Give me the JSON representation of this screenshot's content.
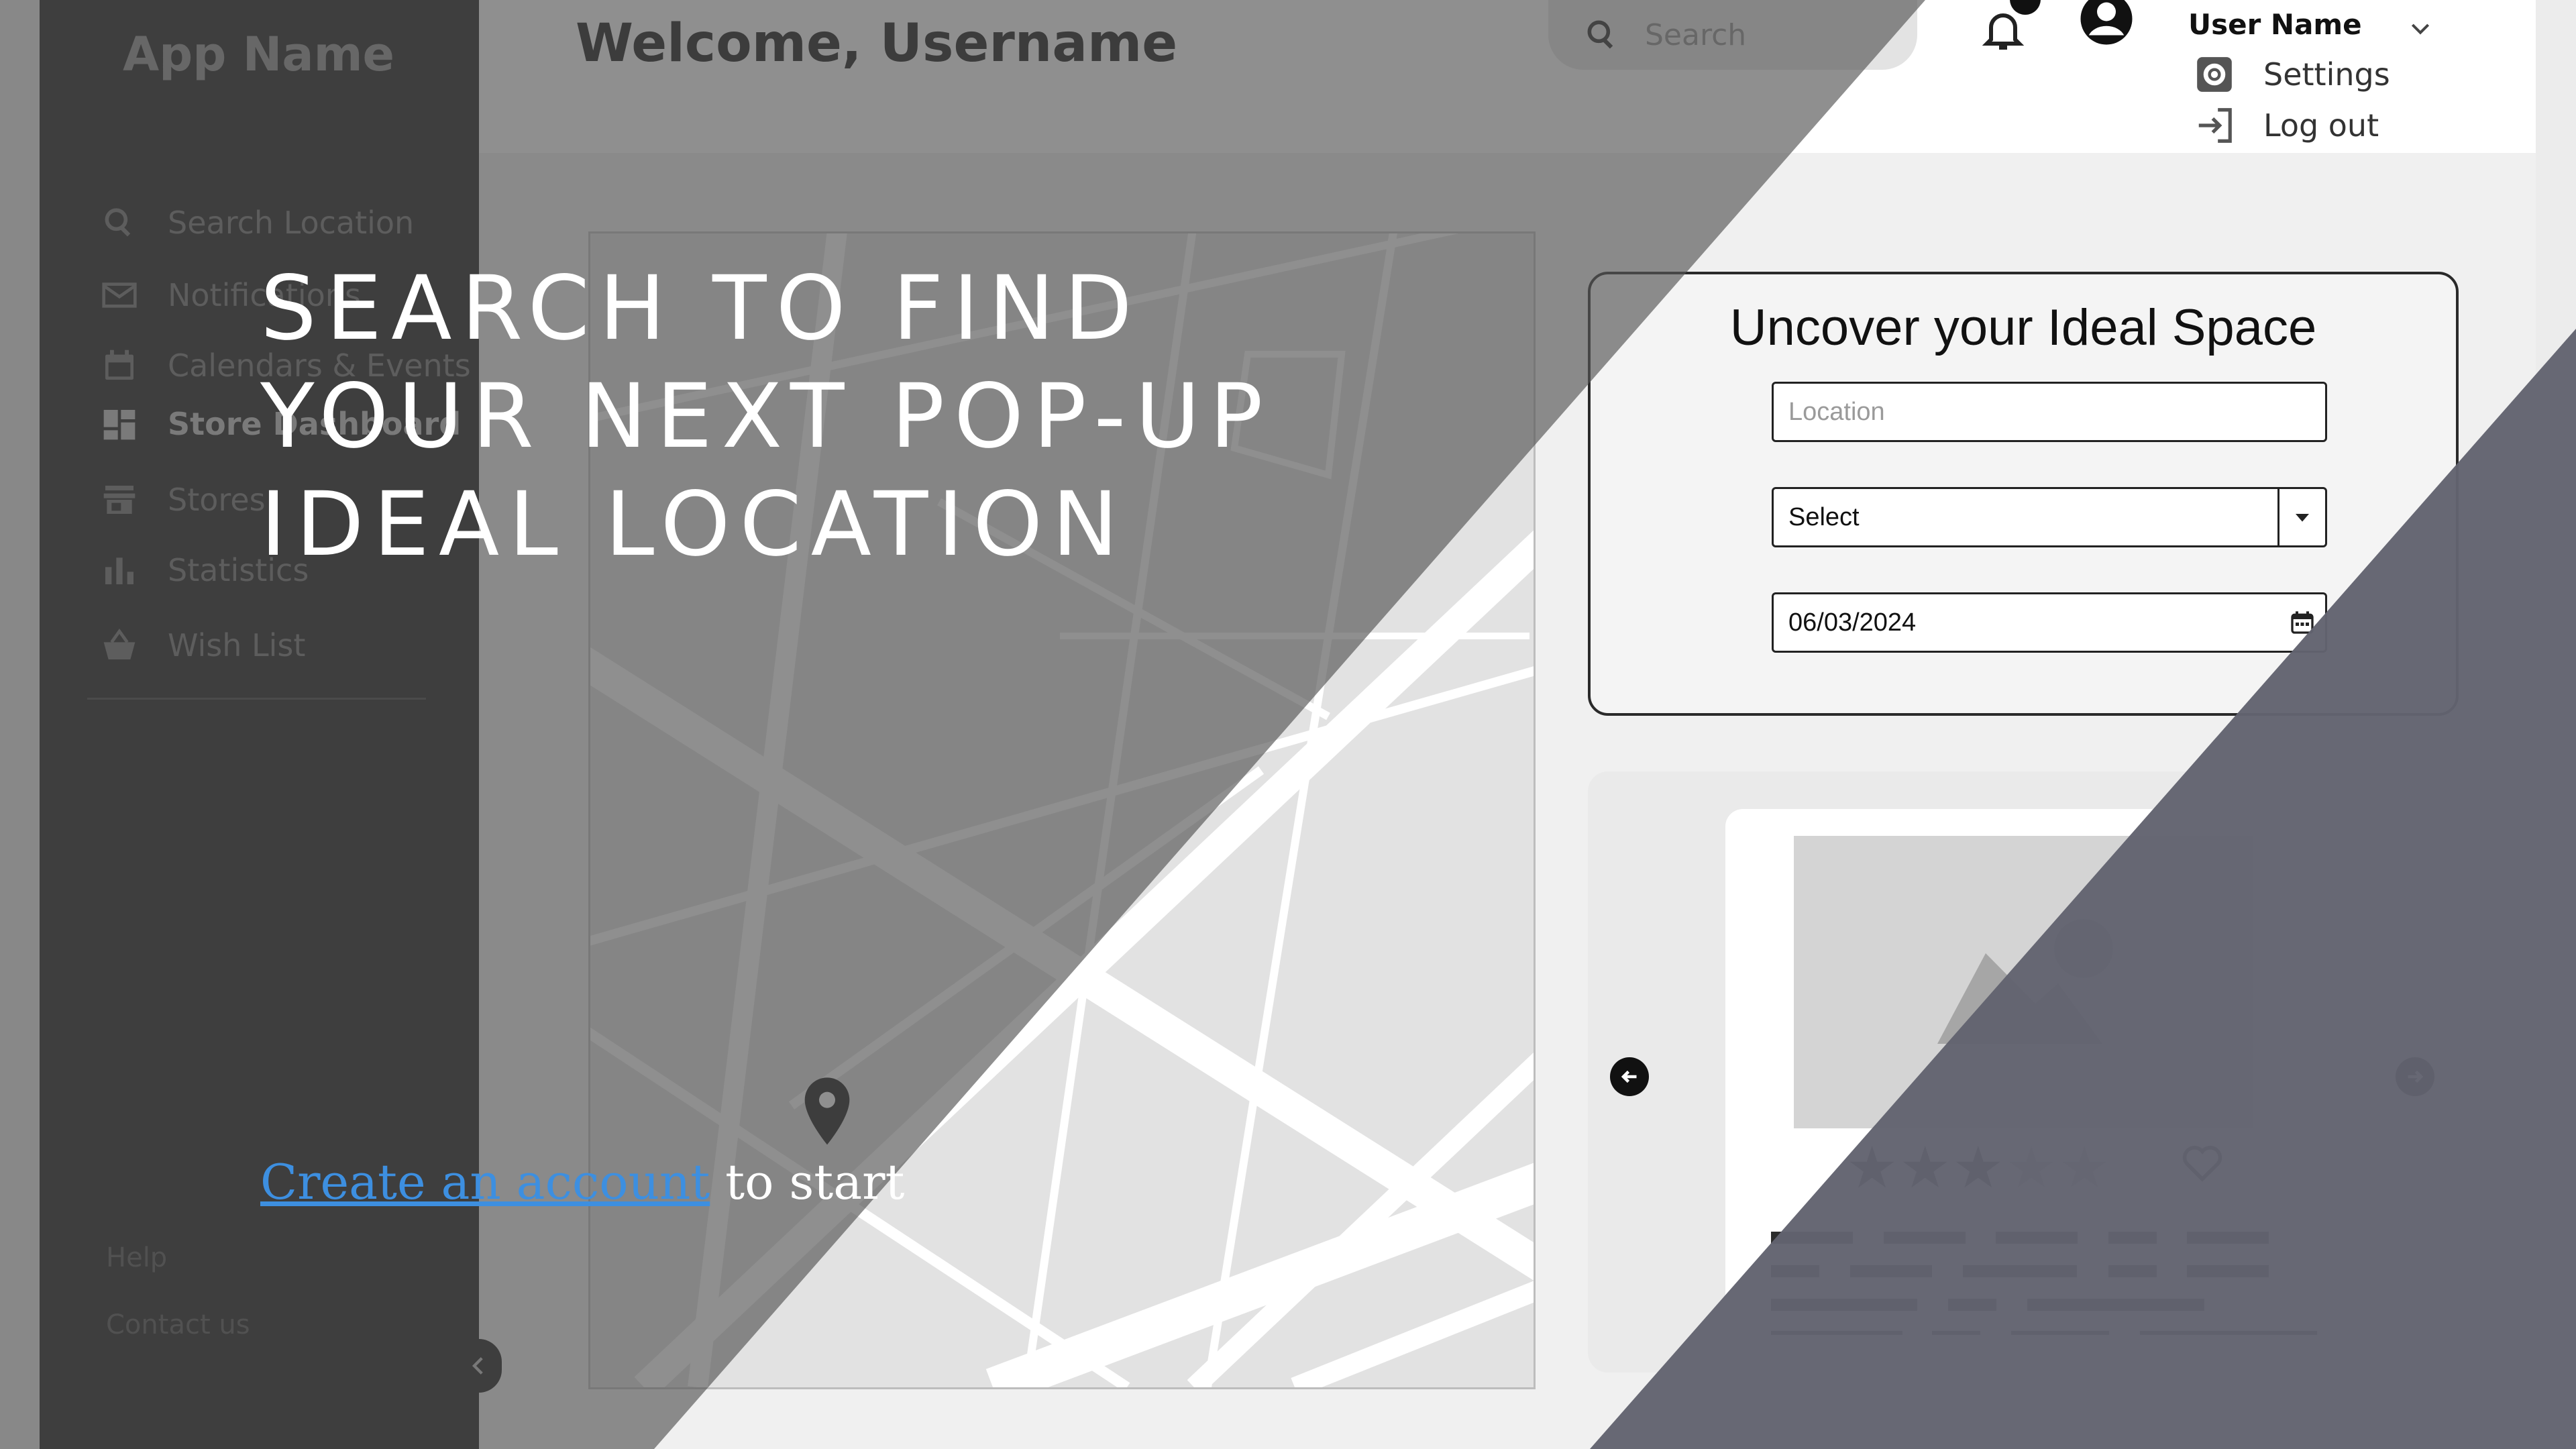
{
  "app": {
    "name": "App Name"
  },
  "sidebar": {
    "items": [
      {
        "label": "Search Location",
        "icon": "search-icon"
      },
      {
        "label": "Notifications",
        "icon": "envelope-icon"
      },
      {
        "label": "Calendars & Events",
        "icon": "calendar-icon"
      },
      {
        "label": "Store Dashboard",
        "icon": "dashboard-icon",
        "active": true
      },
      {
        "label": "Stores",
        "icon": "store-icon"
      },
      {
        "label": "Statistics",
        "icon": "bar-chart-icon"
      },
      {
        "label": "Wish List",
        "icon": "basket-icon"
      }
    ],
    "footer": {
      "help": "Help",
      "contact": "Contact us"
    }
  },
  "header": {
    "welcome": "Welcome, Username",
    "search_placeholder": "Search",
    "user_name": "User Name",
    "menu": {
      "settings": "Settings",
      "logout": "Log out"
    }
  },
  "search_card": {
    "title": "Uncover your Ideal Space",
    "location_placeholder": "Location",
    "select_value": "Select",
    "date_value": "06/03/2024"
  },
  "listing": {
    "rating": 3,
    "max_rating": 5
  },
  "hero": {
    "line1": "SEARCH TO FIND",
    "line2": "YOUR NEXT POP-UP",
    "line3": "IDEAL LOCATION",
    "cta_link": "Create an account",
    "cta_rest": " to start"
  },
  "colors": {
    "overlay_dark": "#555555",
    "overlay_slate": "#62636f",
    "sidebar": "#141414",
    "link": "#3d8fe0"
  }
}
